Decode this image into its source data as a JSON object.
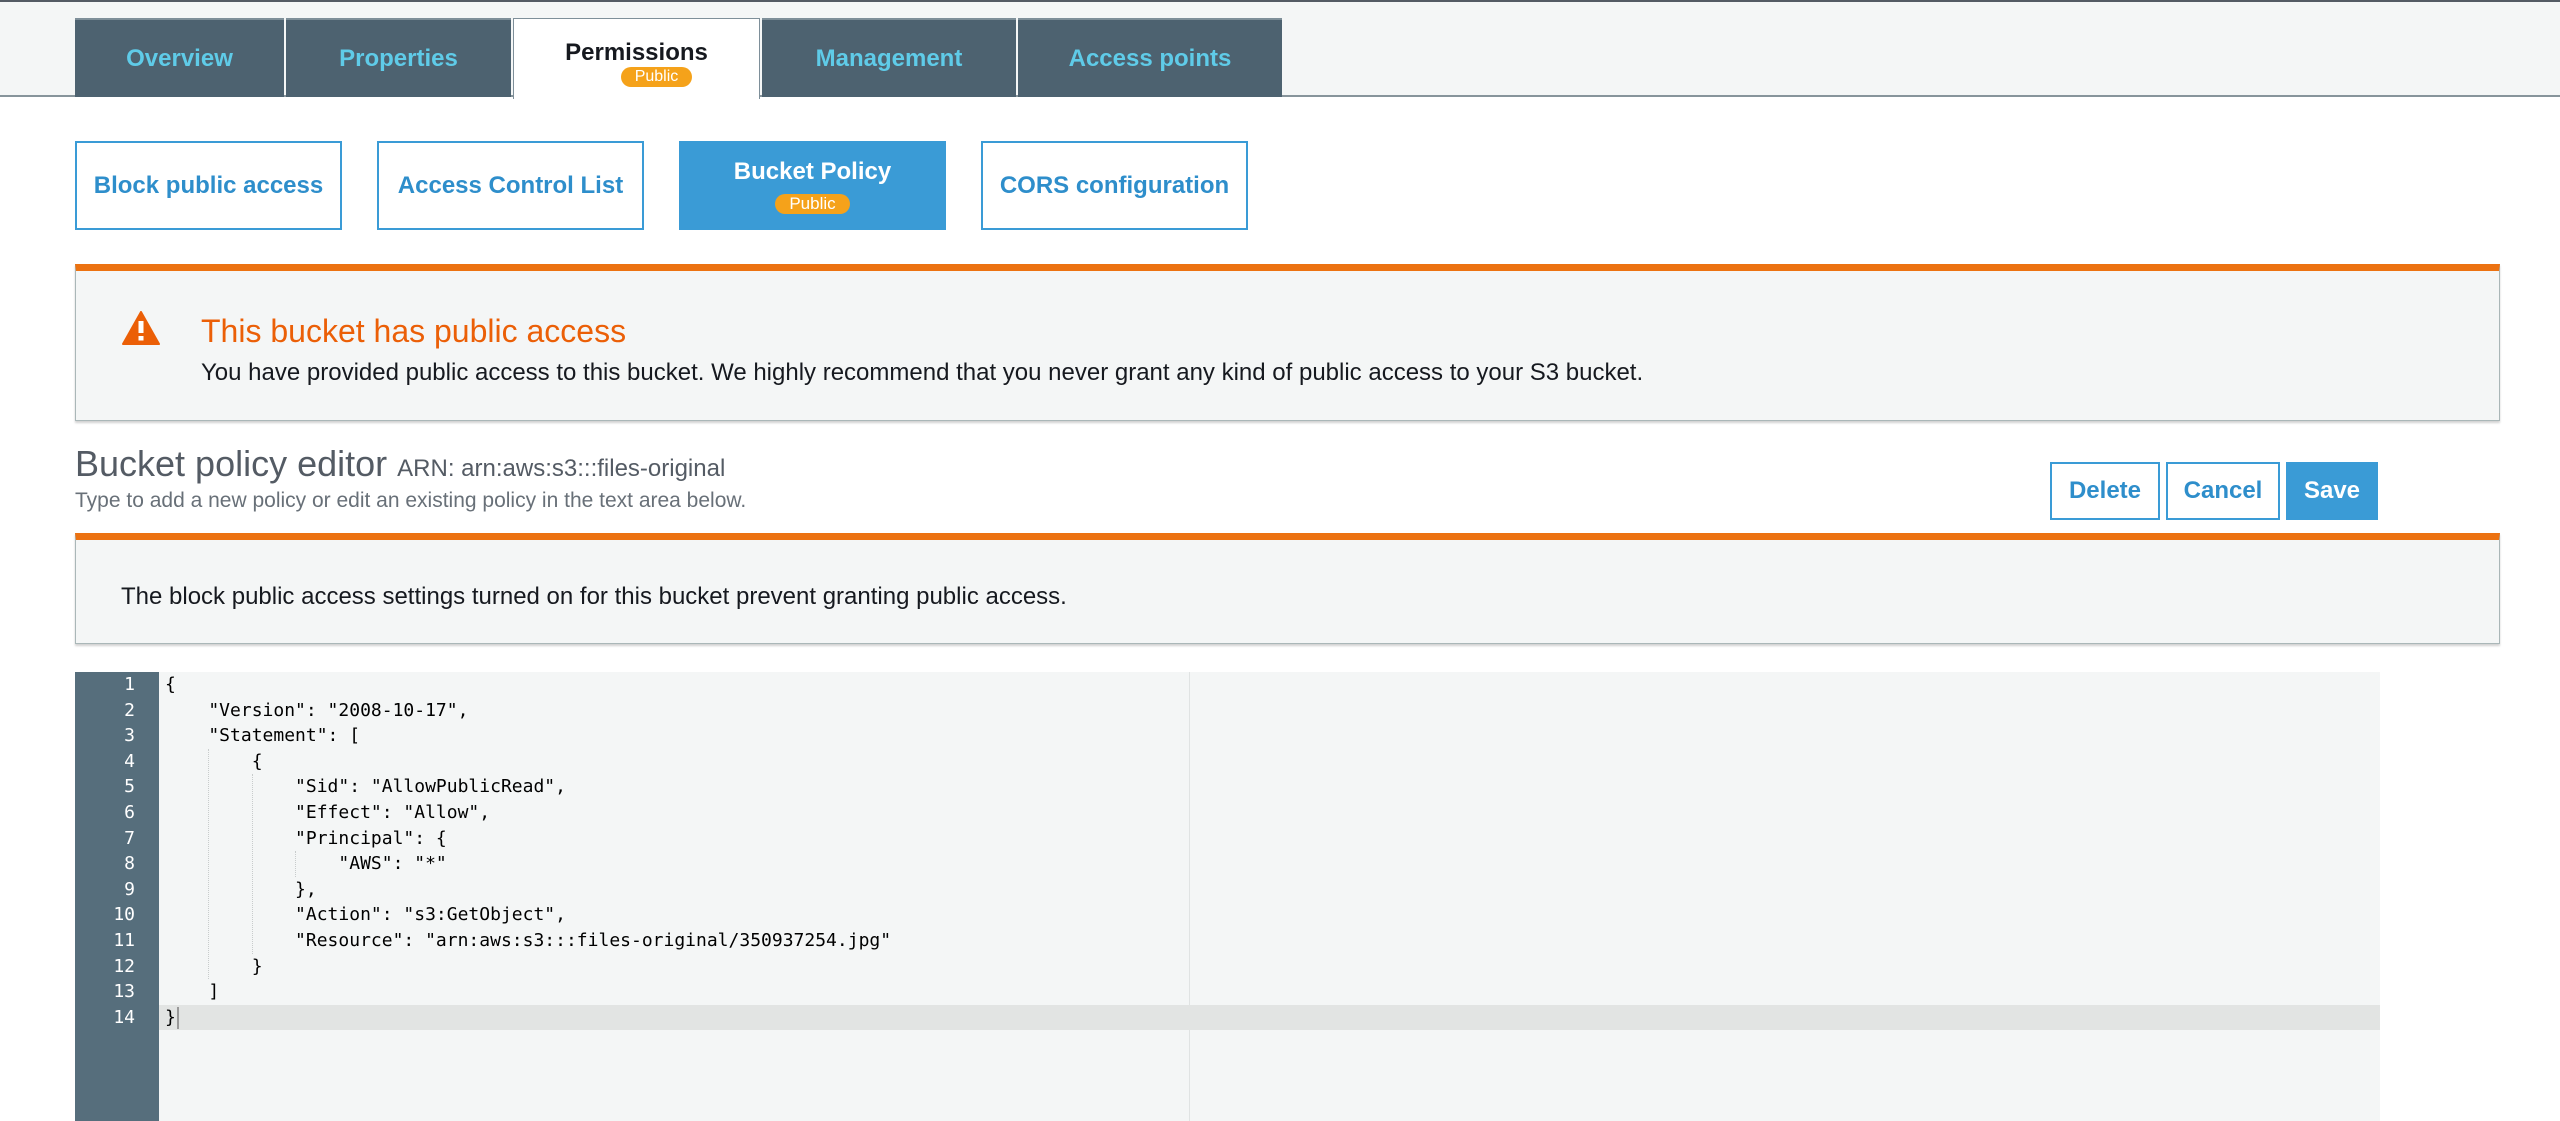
{
  "tabs": [
    {
      "label": "Overview",
      "active": false
    },
    {
      "label": "Properties",
      "active": false
    },
    {
      "label": "Permissions",
      "active": true,
      "badge": "Public"
    },
    {
      "label": "Management",
      "active": false
    },
    {
      "label": "Access points",
      "active": false
    }
  ],
  "subtabs": [
    {
      "label": "Block public access",
      "active": false
    },
    {
      "label": "Access Control List",
      "active": false
    },
    {
      "label": "Bucket Policy",
      "active": true,
      "badge": "Public"
    },
    {
      "label": "CORS configuration",
      "active": false
    }
  ],
  "public_alert": {
    "icon": "warning-icon",
    "title": "This bucket has public access",
    "body": "You have provided public access to this bucket. We highly recommend that you never grant any kind of public access to your S3 bucket."
  },
  "editor_header": {
    "title": "Bucket policy editor",
    "arn_label": "ARN: arn:aws:s3:::files-original",
    "subtitle": "Type to add a new policy or edit an existing policy in the text area below."
  },
  "actions": {
    "delete": "Delete",
    "cancel": "Cancel",
    "save": "Save"
  },
  "block_alert": {
    "body": "The block public access settings turned on for this bucket prevent granting public access."
  },
  "editor": {
    "active_line": 14,
    "lines": [
      "{",
      "    \"Version\": \"2008-10-17\",",
      "    \"Statement\": [",
      "        {",
      "            \"Sid\": \"AllowPublicRead\",",
      "            \"Effect\": \"Allow\",",
      "            \"Principal\": {",
      "                \"AWS\": \"*\"",
      "            },",
      "            \"Action\": \"s3:GetObject\",",
      "            \"Resource\": \"arn:aws:s3:::files-original/350937254.jpg\"",
      "        }",
      "    ]",
      "}"
    ]
  },
  "colors": {
    "accent": "#3a9bd6",
    "warning": "#ec7211",
    "badge": "#f5a21a",
    "tab_bg": "#4d6270",
    "tab_text": "#5fcbe8"
  }
}
